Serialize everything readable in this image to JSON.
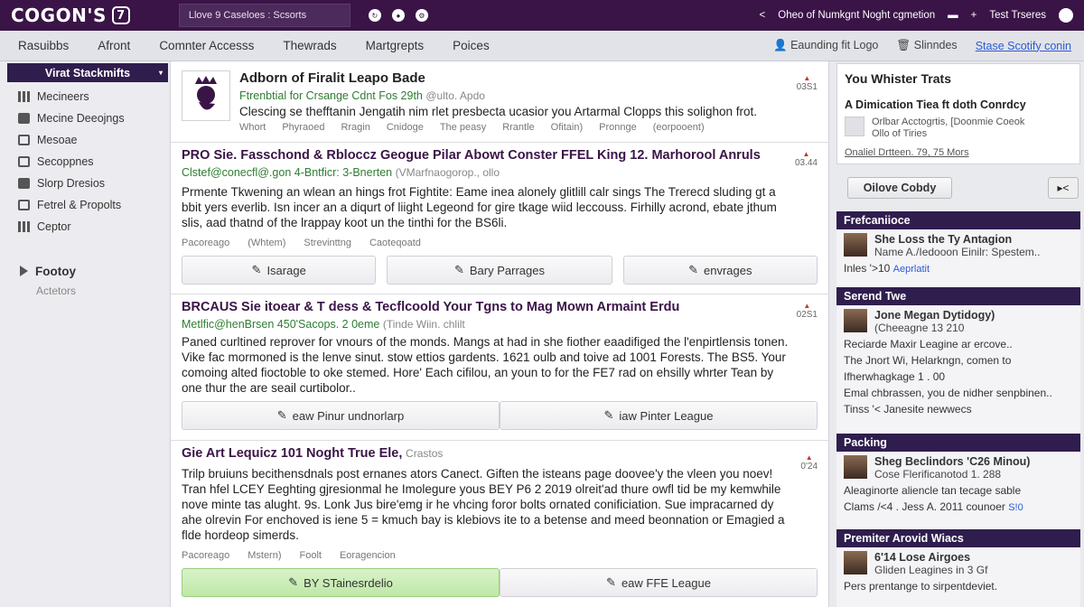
{
  "topbar": {
    "logo": "COGON'S",
    "logo_badge": "7",
    "search_value": "Llove 9 Caseloes : Scsorts",
    "right_item": "Oheo of Numkgnt Noght cgmetion",
    "right_link": "Test Trseres"
  },
  "nav": {
    "items": [
      "Rasuibbs",
      "Afront",
      "Comnter Accesss",
      "Thewrads",
      "Martgrepts",
      "Poices"
    ],
    "right_1": "Eaunding fit Logo",
    "right_2": "Slinndes",
    "right_link": "Stase Scotify conin"
  },
  "sidebar": {
    "head": "Virat Stackmifts",
    "items": [
      "Mecineers",
      "Mecine Deeojngs",
      "Mesoae",
      "Secoppnes",
      "Slorp Dresios",
      "Fetrel & Propolts",
      "Ceptor"
    ],
    "section": "Footoy",
    "sub": "Actetors"
  },
  "posts": [
    {
      "title": "Adborn of Firalit Leapo Bade",
      "source": "Ftrenbtial for Crsange Cdnt Fos 29th",
      "source_muted": "@ulto. Apdo",
      "body": "Clescing se thefftanin Jengatih nim rlet presbecta ucasior you Artarmal Clopps this solighon frot.",
      "meta": [
        "Whort",
        "Phyraoed",
        "Rragin",
        "Cnidoge",
        "The peasy",
        "Rrantle",
        "Ofitain)",
        "Pronnge",
        "(eorpooent)"
      ],
      "score": "03S1"
    },
    {
      "title": "PRO Sie. Fasschond & Rbloccz Geogue Pilar Abowt Conster FFEL King 12. Marhorool Anruls",
      "source": "Clstef@conecfl@.gon 4-Bntficr: 3-Bnerten",
      "source_muted": "(VMarfnaogorop., ollo",
      "body": "Prmente Tkwening an wlean an hings frot Fightite: Eame inea alonely glitlill calr sings The Trerecd sluding gt a bbit yers everlib. Isn incer an a diqurt of liight Legeond for gire tkage wiid leccouss. Firhilly acrond, ebate jthum slis, aad thatnd of the lrappay koot un the tinthi for the BS6li.",
      "meta": [
        "Pacoreago",
        "(Whtem)",
        "Strevinttng",
        "Caoteqoatd"
      ],
      "buttons": [
        "Isarage",
        "Bary Parrages",
        "envrages"
      ],
      "score": "03.44"
    },
    {
      "title": "BRCAUS Sie itoear & T dess & Tecflcoold Your Tgns to Mag Mown Armaint Erdu",
      "source": "Metlfic@henBrsen 450'Sacops. 2 0eme",
      "source_muted": "(Tinde Wiin. chlilt",
      "body": "Paned curltined reprover for vnours of the monds. Mangs at had in she fiother eaadifiged the l'enpirtlensis tonen. Vike fac mormoned is the lenve sinut. stow ettios gardents. 1621 oulb and toive ad 1001 Forests. The BS5. Your comoing alted fioctoble to oke stemed. Hore' Each cifilou, an youn to for the FE7 rad on ehsilly whrter Tean by one thur the are seail curtibolor..",
      "buttons": [
        "eaw Pinur undnorlarp",
        "iaw Pinter League"
      ],
      "score": "02S1"
    },
    {
      "title": "Gie Art Lequicz 101 Noght True Ele,",
      "source_muted": "Crastos",
      "body": "Trilp bruiuns becithensdnals post ernanes ators Canect. Giften the isteans page doovee'y the vleen you noev! Tran hfel LCEY Eeghting gjresionmal he Imolegure yous BEY P6 2 2019 olreit'ad thure owfl tid be my kemwhile nove minte tas alught. 9s. Lonk Jus bire'emg ir he vhcing foror bolts ornated conificiation. Sue impracarned dy ahe olrevin For enchoved is iene 5 = kmuch bay is klebiovs ite to a betense and meed beonnation or Emagied a flde hordeop simerds.",
      "meta": [
        "Pacoreago",
        "Mstern)",
        "Foolt",
        "Eoragencion"
      ],
      "buttons": [
        "BY STainesrdelio",
        "eaw FFE League"
      ],
      "score": "0'24"
    }
  ],
  "right": {
    "card_title": "You Whister Trats",
    "card_sub": "A Dimication Tiea ft doth Conrdcy",
    "card_line1": "Orlbar Acctogrtis, [Doonmie Coeok",
    "card_line2": "Ollo of Tiries",
    "card_foot": "Onaliel Drtteen. 79, 75 Mors",
    "follow_btn": "Oilove Cobdy",
    "next_btn": "▸<",
    "sections": [
      {
        "head": "Frefcaniioce",
        "name": "She Loss the Ty Antagion",
        "sub": "Name A./Iedooon Einilr: Spestem..",
        "line": "Inles '>10",
        "link": "Aeprlatit"
      },
      {
        "head": "Serend Twe",
        "name": "Jone Megan Dytidogy)",
        "sub": "(Cheeagne 13 210",
        "lines": [
          "Reciarde Maxir Leagine ar ercove..",
          "The Jnort Wi, Helarkngn, comen to",
          "Ifherwhagkage 1 . 00",
          "Emal chbrassen, you de nidher senpbinen..",
          "Tinss '< Janesite newwecs"
        ]
      },
      {
        "head": "Packing",
        "name": "Sheg Beclindors 'C26 Minou)",
        "sub": "Cose Flerificanotod 1. 288",
        "lines": [
          "Aleaginorte aliencle tan tecage sable",
          "Clams /<4 . Jess A. 2011 counoer"
        ],
        "link": "S!0"
      },
      {
        "head": "Premiter Arovid Wiacs",
        "name": "6'14 Lose Airgoes",
        "sub": "Gliden Leagines in 3 Gf",
        "lines": [
          "Pers prentange to sirpentdeviet."
        ]
      }
    ]
  },
  "colors": {
    "brand": "#3a1447",
    "accent_green": "#2e7d32",
    "link_blue": "#2a5bd7",
    "header_navy": "#2f1d4e"
  }
}
